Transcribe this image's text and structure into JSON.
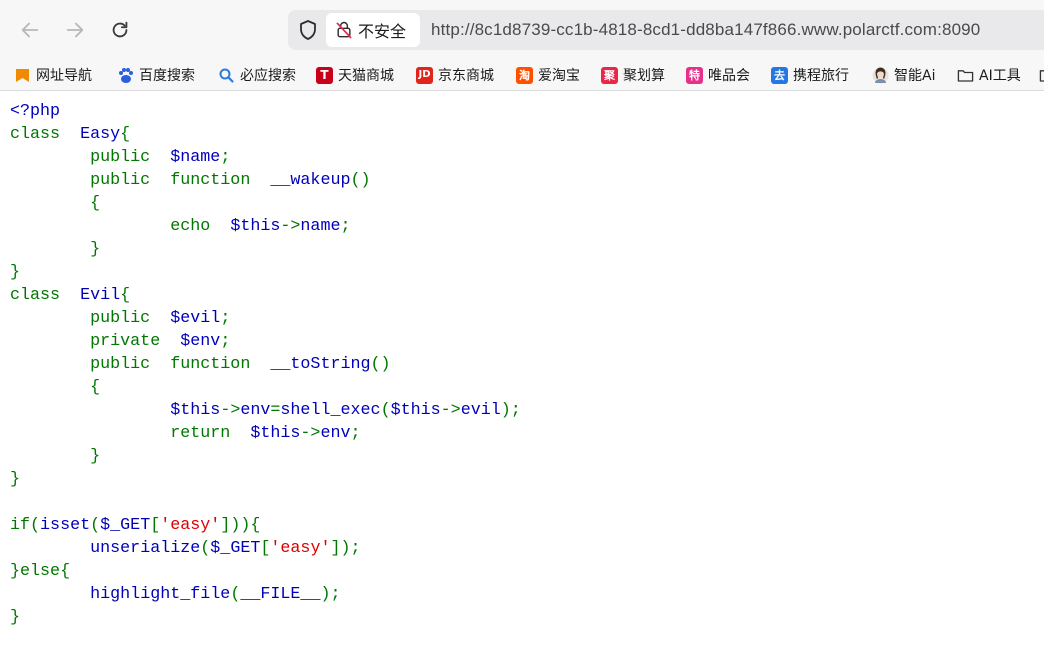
{
  "browser": {
    "security_label": "不安全",
    "url": "http://8c1d8739-cc1b-4818-8cd1-dd8ba147f866.www.polarctf.com:8090",
    "icons": {
      "back": "arrow-left-icon",
      "forward": "arrow-right-icon",
      "reload": "reload-icon",
      "shield": "shield-icon",
      "insecure": "insecure-lock-icon"
    }
  },
  "bookmarks": [
    {
      "label": "网址导航",
      "icon": "bookmark-flag-icon",
      "color": "#f08a00"
    },
    {
      "label": "百度搜索",
      "icon": "baidu-paw-icon",
      "color": "#2a5fe0"
    },
    {
      "label": "必应搜索",
      "icon": "search-icon",
      "color": "#2a7be0"
    },
    {
      "label": "天猫商城",
      "icon": "tmall-icon",
      "color": "#e0001b"
    },
    {
      "label": "京东商城",
      "icon": "jd-icon",
      "color": "#e1251b"
    },
    {
      "label": "爱淘宝",
      "icon": "taobao-icon",
      "color": "#ff5000"
    },
    {
      "label": "聚划算",
      "icon": "juhuasuan-icon",
      "color": "#e8274a"
    },
    {
      "label": "唯品会",
      "icon": "vip-icon",
      "color": "#e8308a"
    },
    {
      "label": "携程旅行",
      "icon": "ctrip-icon",
      "color": "#2577e3"
    },
    {
      "label": "智能Ai",
      "icon": "ai-avatar-icon",
      "color": "#777777"
    },
    {
      "label": "AI工具",
      "icon": "folder-icon",
      "color": "#333333"
    }
  ],
  "code": {
    "lines": [
      [
        [
          "v",
          "<?php"
        ]
      ],
      [
        [
          "k",
          "class  "
        ],
        [
          "v",
          "Easy"
        ],
        [
          "k",
          "{"
        ]
      ],
      [
        [
          "k",
          "        public  "
        ],
        [
          "v",
          "$name"
        ],
        [
          "k",
          ";"
        ]
      ],
      [
        [
          "k",
          "        public  function  "
        ],
        [
          "v",
          "__wakeup"
        ],
        [
          "k",
          "()"
        ]
      ],
      [
        [
          "k",
          "        {"
        ]
      ],
      [
        [
          "k",
          "                echo  "
        ],
        [
          "v",
          "$this"
        ],
        [
          "k",
          "->"
        ],
        [
          "v",
          "name"
        ],
        [
          "k",
          ";"
        ]
      ],
      [
        [
          "k",
          "        }"
        ]
      ],
      [
        [
          "k",
          "}"
        ]
      ],
      [
        [
          "k",
          "class  "
        ],
        [
          "v",
          "Evil"
        ],
        [
          "k",
          "{"
        ]
      ],
      [
        [
          "k",
          "        public  "
        ],
        [
          "v",
          "$evil"
        ],
        [
          "k",
          ";"
        ]
      ],
      [
        [
          "k",
          "        private  "
        ],
        [
          "v",
          "$env"
        ],
        [
          "k",
          ";"
        ]
      ],
      [
        [
          "k",
          "        public  function  "
        ],
        [
          "v",
          "__toString"
        ],
        [
          "k",
          "()"
        ]
      ],
      [
        [
          "k",
          "        {"
        ]
      ],
      [
        [
          "k",
          "                "
        ],
        [
          "v",
          "$this"
        ],
        [
          "k",
          "->"
        ],
        [
          "v",
          "env"
        ],
        [
          "k",
          "="
        ],
        [
          "v",
          "shell_exec"
        ],
        [
          "k",
          "("
        ],
        [
          "v",
          "$this"
        ],
        [
          "k",
          "->"
        ],
        [
          "v",
          "evil"
        ],
        [
          "k",
          ");"
        ]
      ],
      [
        [
          "k",
          "                return  "
        ],
        [
          "v",
          "$this"
        ],
        [
          "k",
          "->"
        ],
        [
          "v",
          "env"
        ],
        [
          "k",
          ";"
        ]
      ],
      [
        [
          "k",
          "        }"
        ]
      ],
      [
        [
          "k",
          "}"
        ]
      ],
      [
        [
          "k",
          ""
        ]
      ],
      [
        [
          "k",
          "if("
        ],
        [
          "v",
          "isset"
        ],
        [
          "k",
          "("
        ],
        [
          "v",
          "$_GET"
        ],
        [
          "k",
          "["
        ],
        [
          "s",
          "'easy'"
        ],
        [
          "k",
          "])){"
        ]
      ],
      [
        [
          "k",
          "        "
        ],
        [
          "v",
          "unserialize"
        ],
        [
          "k",
          "("
        ],
        [
          "v",
          "$_GET"
        ],
        [
          "k",
          "["
        ],
        [
          "s",
          "'easy'"
        ],
        [
          "k",
          "]);"
        ]
      ],
      [
        [
          "k",
          "}else{"
        ]
      ],
      [
        [
          "k",
          "        "
        ],
        [
          "v",
          "highlight_file"
        ],
        [
          "k",
          "("
        ],
        [
          "v",
          "__FILE__"
        ],
        [
          "k",
          ");"
        ]
      ],
      [
        [
          "k",
          "}"
        ]
      ]
    ]
  }
}
